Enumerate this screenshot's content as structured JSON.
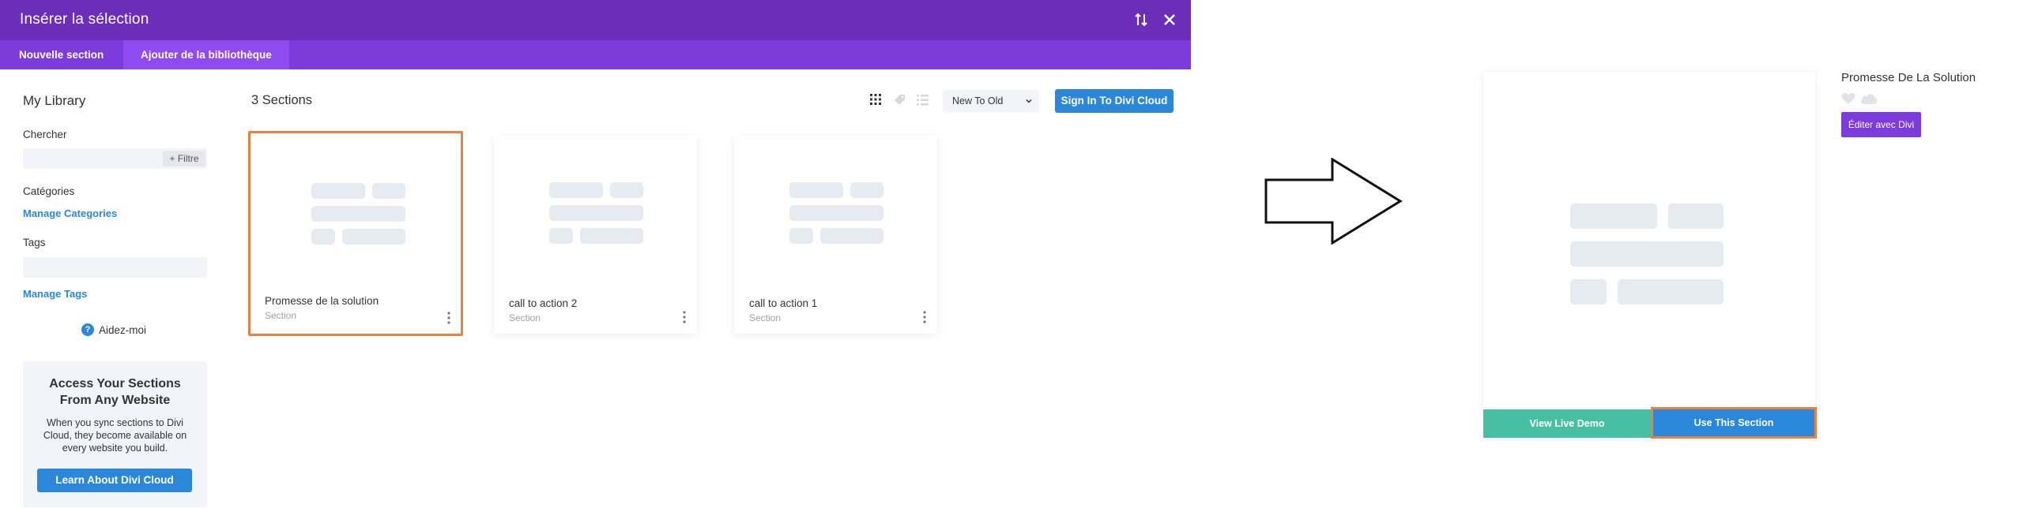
{
  "modal": {
    "title": "Insérer la sélection",
    "tabs": [
      {
        "label": "Nouvelle section",
        "active": false
      },
      {
        "label": "Ajouter de la bibliothèque",
        "active": true
      }
    ]
  },
  "sidebar": {
    "heading": "My Library",
    "search_label": "Chercher",
    "search_value": "",
    "filter_label": "+ Filtre",
    "categories_label": "Catégories",
    "manage_categories": "Manage Categories",
    "tags_label": "Tags",
    "manage_tags": "Manage Tags",
    "help_label": "Aidez-moi",
    "promo": {
      "title": "Access Your Sections From Any Website",
      "text": "When you sync sections to Divi Cloud, they become available on every website you build.",
      "button": "Learn About Divi Cloud"
    }
  },
  "main": {
    "count_label": "3 Sections",
    "sort_value": "New To Old",
    "signin_label": "Sign In To Divi Cloud",
    "cards": [
      {
        "title": "Promesse de la solution",
        "type": "Section",
        "selected": true
      },
      {
        "title": "call to action 2",
        "type": "Section",
        "selected": false
      },
      {
        "title": "call to action 1",
        "type": "Section",
        "selected": false
      }
    ]
  },
  "preview": {
    "title": "Promesse De La Solution",
    "live_demo": "View Live Demo",
    "use_section": "Use This Section",
    "edit_divi": "Éditer avec Divi"
  },
  "colors": {
    "header_purple": "#6c2eb9",
    "tab_purple": "#7d3bdc",
    "accent_blue": "#2b87da",
    "highlight_orange": "#e8823c",
    "teal": "#47bfa2",
    "placeholder": "#e6ebf2"
  },
  "icons": [
    "sort-icon",
    "close-icon",
    "help-icon",
    "grid-view-icon",
    "tag-icon",
    "list-view-icon",
    "chevron-down-icon",
    "more-vertical-icon",
    "right-arrow-icon",
    "heart-icon",
    "cloud-icon"
  ]
}
